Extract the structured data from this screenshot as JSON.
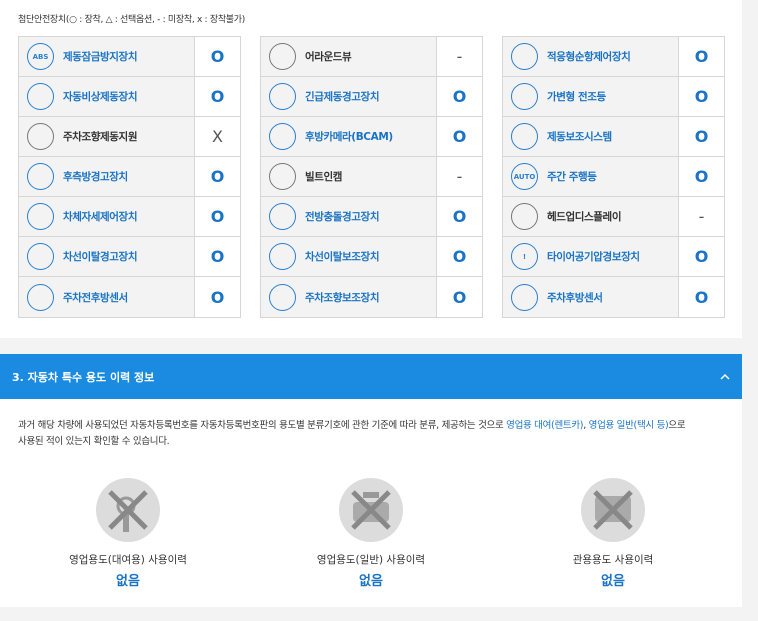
{
  "legend": "첨단안전장치(○ : 장착, △ : 선택옵션, - : 미장착, x : 장착불가)",
  "columns": [
    [
      {
        "icon": "abs-icon",
        "icon_text": "ABS",
        "label": "제동잠금방지장치",
        "value": "O",
        "active": true
      },
      {
        "icon": "car-brake-icon",
        "icon_text": "",
        "label": "자동비상제동장치",
        "value": "O",
        "active": true
      },
      {
        "icon": "parking-steer-icon",
        "icon_text": "",
        "label": "주차조향제동지원",
        "value": "X",
        "active": false
      },
      {
        "icon": "blindspot-icon",
        "icon_text": "",
        "label": "후측방경고장치",
        "value": "O",
        "active": true
      },
      {
        "icon": "stability-icon",
        "icon_text": "",
        "label": "차체자세제어장치",
        "value": "O",
        "active": true
      },
      {
        "icon": "lane-departure-icon",
        "icon_text": "",
        "label": "차선이탈경고장치",
        "value": "O",
        "active": true
      },
      {
        "icon": "rear-sensor-icon",
        "icon_text": "",
        "label": "주차전후방센서",
        "value": "O",
        "active": true
      }
    ],
    [
      {
        "icon": "around-view-icon",
        "icon_text": "",
        "label": "어라운드뷰",
        "value": "-",
        "active": false
      },
      {
        "icon": "emergency-brake-warning-icon",
        "icon_text": "",
        "label": "긴급제동경고장치",
        "value": "O",
        "active": true
      },
      {
        "icon": "rear-camera-icon",
        "icon_text": "",
        "label": "후방카메라(BCAM)",
        "value": "O",
        "active": true
      },
      {
        "icon": "builtin-cam-icon",
        "icon_text": "",
        "label": "빌트인캠",
        "value": "-",
        "active": false
      },
      {
        "icon": "forward-collision-icon",
        "icon_text": "",
        "label": "전방충돌경고장치",
        "value": "O",
        "active": true
      },
      {
        "icon": "lane-keep-icon",
        "icon_text": "",
        "label": "차선이탈보조장치",
        "value": "O",
        "active": true
      },
      {
        "icon": "parking-assist-icon",
        "icon_text": "",
        "label": "주차조향보조장치",
        "value": "O",
        "active": true
      }
    ],
    [
      {
        "icon": "adaptive-cruise-icon",
        "icon_text": "",
        "label": "적응형순항제어장치",
        "value": "O",
        "active": true
      },
      {
        "icon": "adaptive-headlight-icon",
        "icon_text": "",
        "label": "가변형 전조등",
        "value": "O",
        "active": true
      },
      {
        "icon": "brake-assist-icon",
        "icon_text": "",
        "label": "제동보조시스템",
        "value": "O",
        "active": true
      },
      {
        "icon": "drl-icon",
        "icon_text": "AUTO",
        "label": "주간 주행등",
        "value": "O",
        "active": true
      },
      {
        "icon": "hud-icon",
        "icon_text": "",
        "label": "헤드업디스플레이",
        "value": "-",
        "active": false
      },
      {
        "icon": "tire-pressure-icon",
        "icon_text": "!",
        "label": "타이어공기압경보장치",
        "value": "O",
        "active": true
      },
      {
        "icon": "rear-park-sensor-icon",
        "icon_text": "",
        "label": "주차후방센서",
        "value": "O",
        "active": true
      }
    ]
  ],
  "section": {
    "title": "3. 자동차 특수 용도 이력 정보"
  },
  "desc": {
    "part1": "과거 해당 차량에 사용되었던 자동차등록번호를 자동차등록번호판의 용도별 분류기호에 관한 기준에 따라 분류, 제공하는 것으로 ",
    "hl1": "영업용 대여(렌트카)",
    "part2": ", ",
    "hl2": "영업용 일반(택시 등)",
    "part3": "으로",
    "line2": "사용된 적이 있는지 확인할 수 있습니다."
  },
  "usages": [
    {
      "label": "영업용도(대여용) 사용이력",
      "value": "없음"
    },
    {
      "label": "영업용도(일반) 사용이력",
      "value": "없음"
    },
    {
      "label": "관용용도 사용이력",
      "value": "없음"
    }
  ]
}
